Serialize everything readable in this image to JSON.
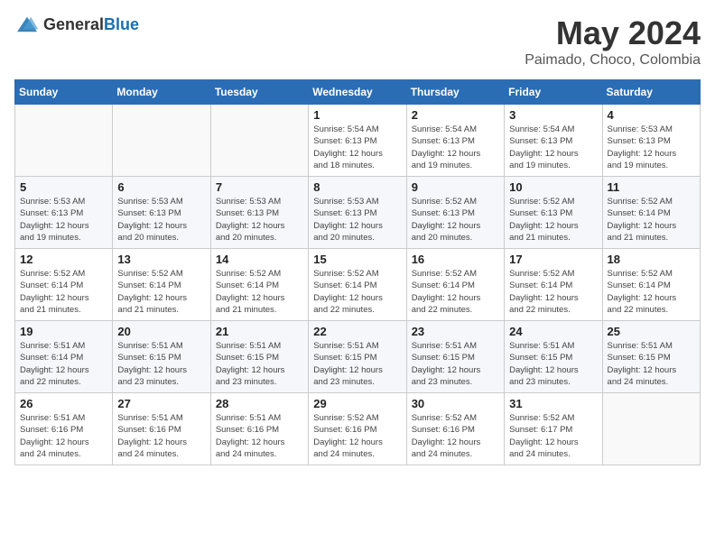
{
  "header": {
    "logo_general": "General",
    "logo_blue": "Blue",
    "title": "May 2024",
    "subtitle": "Paimado, Choco, Colombia"
  },
  "weekdays": [
    "Sunday",
    "Monday",
    "Tuesday",
    "Wednesday",
    "Thursday",
    "Friday",
    "Saturday"
  ],
  "weeks": [
    [
      {
        "day": "",
        "info": ""
      },
      {
        "day": "",
        "info": ""
      },
      {
        "day": "",
        "info": ""
      },
      {
        "day": "1",
        "info": "Sunrise: 5:54 AM\nSunset: 6:13 PM\nDaylight: 12 hours\nand 18 minutes."
      },
      {
        "day": "2",
        "info": "Sunrise: 5:54 AM\nSunset: 6:13 PM\nDaylight: 12 hours\nand 19 minutes."
      },
      {
        "day": "3",
        "info": "Sunrise: 5:54 AM\nSunset: 6:13 PM\nDaylight: 12 hours\nand 19 minutes."
      },
      {
        "day": "4",
        "info": "Sunrise: 5:53 AM\nSunset: 6:13 PM\nDaylight: 12 hours\nand 19 minutes."
      }
    ],
    [
      {
        "day": "5",
        "info": "Sunrise: 5:53 AM\nSunset: 6:13 PM\nDaylight: 12 hours\nand 19 minutes."
      },
      {
        "day": "6",
        "info": "Sunrise: 5:53 AM\nSunset: 6:13 PM\nDaylight: 12 hours\nand 20 minutes."
      },
      {
        "day": "7",
        "info": "Sunrise: 5:53 AM\nSunset: 6:13 PM\nDaylight: 12 hours\nand 20 minutes."
      },
      {
        "day": "8",
        "info": "Sunrise: 5:53 AM\nSunset: 6:13 PM\nDaylight: 12 hours\nand 20 minutes."
      },
      {
        "day": "9",
        "info": "Sunrise: 5:52 AM\nSunset: 6:13 PM\nDaylight: 12 hours\nand 20 minutes."
      },
      {
        "day": "10",
        "info": "Sunrise: 5:52 AM\nSunset: 6:13 PM\nDaylight: 12 hours\nand 21 minutes."
      },
      {
        "day": "11",
        "info": "Sunrise: 5:52 AM\nSunset: 6:14 PM\nDaylight: 12 hours\nand 21 minutes."
      }
    ],
    [
      {
        "day": "12",
        "info": "Sunrise: 5:52 AM\nSunset: 6:14 PM\nDaylight: 12 hours\nand 21 minutes."
      },
      {
        "day": "13",
        "info": "Sunrise: 5:52 AM\nSunset: 6:14 PM\nDaylight: 12 hours\nand 21 minutes."
      },
      {
        "day": "14",
        "info": "Sunrise: 5:52 AM\nSunset: 6:14 PM\nDaylight: 12 hours\nand 21 minutes."
      },
      {
        "day": "15",
        "info": "Sunrise: 5:52 AM\nSunset: 6:14 PM\nDaylight: 12 hours\nand 22 minutes."
      },
      {
        "day": "16",
        "info": "Sunrise: 5:52 AM\nSunset: 6:14 PM\nDaylight: 12 hours\nand 22 minutes."
      },
      {
        "day": "17",
        "info": "Sunrise: 5:52 AM\nSunset: 6:14 PM\nDaylight: 12 hours\nand 22 minutes."
      },
      {
        "day": "18",
        "info": "Sunrise: 5:52 AM\nSunset: 6:14 PM\nDaylight: 12 hours\nand 22 minutes."
      }
    ],
    [
      {
        "day": "19",
        "info": "Sunrise: 5:51 AM\nSunset: 6:14 PM\nDaylight: 12 hours\nand 22 minutes."
      },
      {
        "day": "20",
        "info": "Sunrise: 5:51 AM\nSunset: 6:15 PM\nDaylight: 12 hours\nand 23 minutes."
      },
      {
        "day": "21",
        "info": "Sunrise: 5:51 AM\nSunset: 6:15 PM\nDaylight: 12 hours\nand 23 minutes."
      },
      {
        "day": "22",
        "info": "Sunrise: 5:51 AM\nSunset: 6:15 PM\nDaylight: 12 hours\nand 23 minutes."
      },
      {
        "day": "23",
        "info": "Sunrise: 5:51 AM\nSunset: 6:15 PM\nDaylight: 12 hours\nand 23 minutes."
      },
      {
        "day": "24",
        "info": "Sunrise: 5:51 AM\nSunset: 6:15 PM\nDaylight: 12 hours\nand 23 minutes."
      },
      {
        "day": "25",
        "info": "Sunrise: 5:51 AM\nSunset: 6:15 PM\nDaylight: 12 hours\nand 24 minutes."
      }
    ],
    [
      {
        "day": "26",
        "info": "Sunrise: 5:51 AM\nSunset: 6:16 PM\nDaylight: 12 hours\nand 24 minutes."
      },
      {
        "day": "27",
        "info": "Sunrise: 5:51 AM\nSunset: 6:16 PM\nDaylight: 12 hours\nand 24 minutes."
      },
      {
        "day": "28",
        "info": "Sunrise: 5:51 AM\nSunset: 6:16 PM\nDaylight: 12 hours\nand 24 minutes."
      },
      {
        "day": "29",
        "info": "Sunrise: 5:52 AM\nSunset: 6:16 PM\nDaylight: 12 hours\nand 24 minutes."
      },
      {
        "day": "30",
        "info": "Sunrise: 5:52 AM\nSunset: 6:16 PM\nDaylight: 12 hours\nand 24 minutes."
      },
      {
        "day": "31",
        "info": "Sunrise: 5:52 AM\nSunset: 6:17 PM\nDaylight: 12 hours\nand 24 minutes."
      },
      {
        "day": "",
        "info": ""
      }
    ]
  ]
}
